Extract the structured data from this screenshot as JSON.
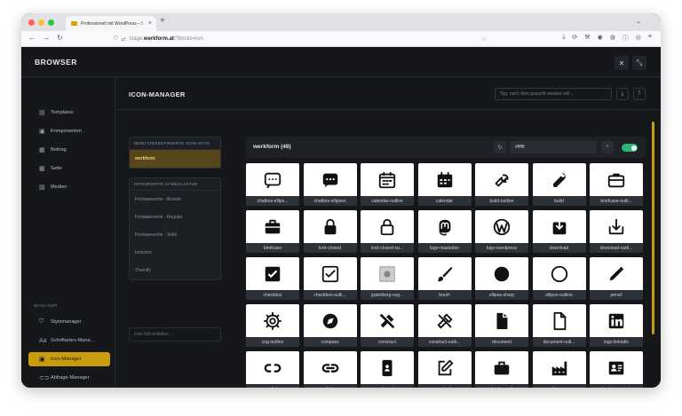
{
  "browser": {
    "tab_title": "Professionell mit WordPress – I",
    "url_prefix": "stage.",
    "url_domain": "werkform.at",
    "url_path": "/?bricks=run"
  },
  "app": {
    "brand": "BROWSER",
    "sidebar": {
      "items": [
        {
          "label": "Templates",
          "icon": "template-icon"
        },
        {
          "label": "Komponenten",
          "icon": "component-icon"
        },
        {
          "label": "Beitrag",
          "icon": "post-icon"
        },
        {
          "label": "Seite",
          "icon": "page-icon"
        },
        {
          "label": "Medien",
          "icon": "media-icon"
        }
      ],
      "manager_label": "MANAGER",
      "manager_items": [
        {
          "label": "Stylemanager",
          "icon": "style-icon"
        },
        {
          "label": "Schriftarten-Mana...",
          "icon": "font-icon"
        },
        {
          "label": "Icon-Manager",
          "icon": "icon-manager-icon",
          "active": true
        },
        {
          "label": "Abfrage-Manager",
          "icon": "query-icon"
        }
      ]
    },
    "main": {
      "title": "ICON-MANAGER",
      "search_placeholder": "Typ, nach dem gesucht werden soll...",
      "custom_sets_label": "BENUTZERDEFINIERTE ICON-SETS",
      "custom_sets": [
        "werkform"
      ],
      "builtin_label": "INTEGRIERTE SYMBOLSÄTZE",
      "builtin_sets": [
        "Fontawesome - Brands",
        "Fontawesome - Regular",
        "Fontawesome - Solid",
        "Ionicons",
        "Themify"
      ],
      "create_placeholder": "Icon-Set erstellen ...",
      "panel": {
        "title": "werkform (48)",
        "color_value": "#ffffff",
        "toggle_on": true
      },
      "icons": [
        "chatbox-ellips...",
        "chatbox-ellipses",
        "calendar-outline",
        "calendar",
        "build-outline",
        "build",
        "briefcase-outli...",
        "briefcase",
        "lock-closed",
        "lock-closed-ou...",
        "logo-mastodon",
        "logo-wordpress",
        "download",
        "download-outli...",
        "checkbox",
        "checkbox-outli...",
        "gutenberg-svg...",
        "brush",
        "ellipse-sharp",
        "ellipse-outline",
        "pencil",
        "cog-outline",
        "compass",
        "construct",
        "construct-outli...",
        "document",
        "document-outl...",
        "logo-linkedin",
        "unlink",
        "link",
        "id-card",
        "write-f",
        "briefcase-1",
        "factory",
        "business-card"
      ]
    }
  }
}
